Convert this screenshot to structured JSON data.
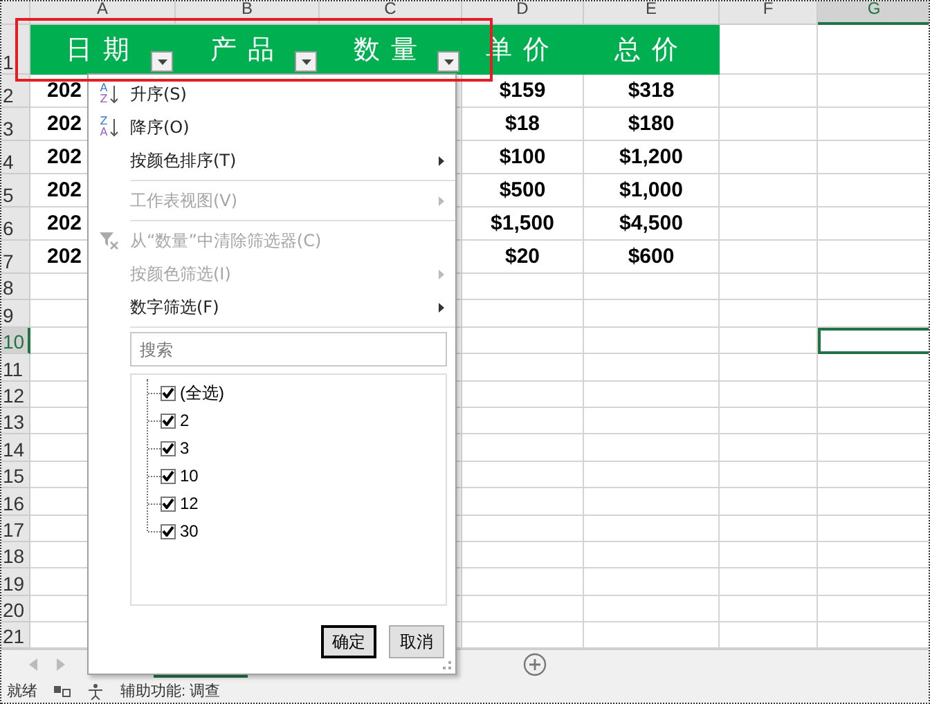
{
  "columns": [
    {
      "label": "A",
      "selected": false
    },
    {
      "label": "B",
      "selected": false
    },
    {
      "label": "C",
      "selected": false
    },
    {
      "label": "D",
      "selected": false
    },
    {
      "label": "E",
      "selected": false
    },
    {
      "label": "F",
      "selected": false
    },
    {
      "label": "G",
      "selected": true
    }
  ],
  "row_numbers": [
    {
      "label": "1",
      "selected": false
    },
    {
      "label": "2",
      "selected": false
    },
    {
      "label": "3",
      "selected": false
    },
    {
      "label": "4",
      "selected": false
    },
    {
      "label": "5",
      "selected": false
    },
    {
      "label": "6",
      "selected": false
    },
    {
      "label": "7",
      "selected": false
    },
    {
      "label": "8",
      "selected": false
    },
    {
      "label": "9",
      "selected": false
    },
    {
      "label": "10",
      "selected": true
    },
    {
      "label": "11",
      "selected": false
    },
    {
      "label": "12",
      "selected": false
    },
    {
      "label": "13",
      "selected": false
    },
    {
      "label": "14",
      "selected": false
    },
    {
      "label": "15",
      "selected": false
    },
    {
      "label": "16",
      "selected": false
    },
    {
      "label": "17",
      "selected": false
    },
    {
      "label": "18",
      "selected": false
    },
    {
      "label": "19",
      "selected": false
    },
    {
      "label": "20",
      "selected": false
    },
    {
      "label": "21",
      "selected": false
    }
  ],
  "header_row": [
    {
      "text": "日期",
      "filter": true
    },
    {
      "text": "产品",
      "filter": true
    },
    {
      "text": "数量",
      "filter": true
    },
    {
      "text": "单价",
      "filter": false
    },
    {
      "text": "总价",
      "filter": false
    }
  ],
  "data_rows": [
    [
      "202",
      null,
      null,
      "$159",
      "$318",
      null,
      null
    ],
    [
      "202",
      null,
      null,
      "$18",
      "$180",
      null,
      null
    ],
    [
      "202",
      null,
      null,
      "$100",
      "$1,200",
      null,
      null
    ],
    [
      "202",
      null,
      null,
      "$500",
      "$1,000",
      null,
      null
    ],
    [
      "202",
      null,
      null,
      "$1,500",
      "$4,500",
      null,
      null
    ],
    [
      "202",
      null,
      null,
      "$20",
      "$600",
      null,
      null
    ]
  ],
  "filter_menu": {
    "items": [
      {
        "kind": "sort",
        "icon_letters": [
          "A",
          "Z"
        ],
        "label": "升序(S)",
        "disabled": false,
        "submenu": false
      },
      {
        "kind": "sort",
        "icon_letters": [
          "Z",
          "A"
        ],
        "label": "降序(O)",
        "disabled": false,
        "submenu": false
      },
      {
        "kind": "plain",
        "label": "按颜色排序(T)",
        "disabled": false,
        "submenu": true
      },
      {
        "kind": "separator"
      },
      {
        "kind": "plain",
        "label": "工作表视图(V)",
        "disabled": true,
        "submenu": true
      },
      {
        "kind": "separator"
      },
      {
        "kind": "clear",
        "label": "从“数量”中清除筛选器(C)",
        "disabled": true,
        "submenu": false
      },
      {
        "kind": "plain",
        "label": "按颜色筛选(I)",
        "disabled": true,
        "submenu": true
      },
      {
        "kind": "plain",
        "label": "数字筛选(F)",
        "disabled": false,
        "submenu": true
      },
      {
        "kind": "separator"
      }
    ],
    "search": {
      "placeholder": "搜索"
    },
    "values": [
      {
        "label": "(全选)",
        "checked": true
      },
      {
        "label": "2",
        "checked": true
      },
      {
        "label": "3",
        "checked": true
      },
      {
        "label": "10",
        "checked": true
      },
      {
        "label": "12",
        "checked": true
      },
      {
        "label": "30",
        "checked": true
      }
    ],
    "buttons": [
      {
        "label": "确定",
        "default": true
      },
      {
        "label": "取消",
        "default": false
      }
    ]
  },
  "sheet_tabs": [
    {
      "selected": true
    }
  ],
  "status_bar": {
    "items": [
      "就绪",
      "辅助功能: 调查"
    ]
  }
}
